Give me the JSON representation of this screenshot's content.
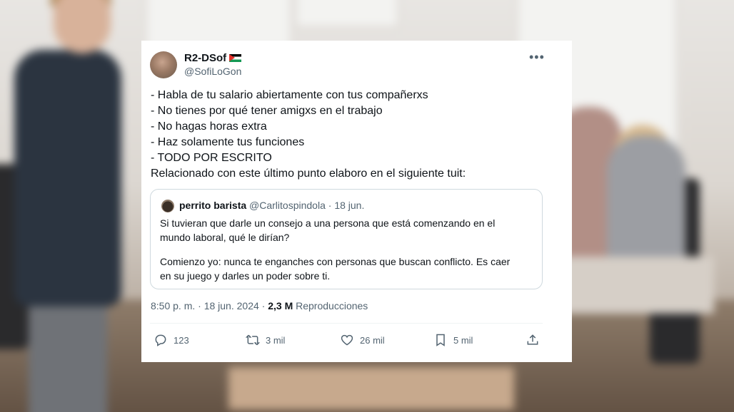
{
  "tweet": {
    "display_name": "R2-DSof",
    "flag_icon": "palestine-flag-icon",
    "handle": "@SofiLoGon",
    "body_lines": [
      "- Habla de tu salario abiertamente con tus compañerxs",
      "- No tienes por qué tener amigxs en el trabajo",
      "- No hagas horas extra",
      "- Haz solamente tus funciones",
      "- TODO POR ESCRITO",
      "Relacionado con este último punto elaboro en el siguiente tuit:"
    ],
    "quoted": {
      "display_name": "perrito barista",
      "handle": "@Carlitospindola",
      "separator": "·",
      "date": "18 jun.",
      "paragraph1_lines": [
        "Si tuvieran que darle un consejo a una persona que está comenzando en el",
        "mundo laboral, qué le dirían?"
      ],
      "paragraph2_lines": [
        "Comienzo yo: nunca te enganches con personas que buscan conflicto. Es caer",
        "en su juego y darles un poder sobre ti."
      ]
    },
    "timestamp": "8:50 p. m. · 18 jun. 2024 ·",
    "views_count": "2,3 M",
    "views_label": "Reproducciones",
    "actions": {
      "replies": "123",
      "retweets": "3 mil",
      "likes": "26 mil",
      "bookmarks": "5 mil"
    }
  },
  "colors": {
    "text_primary": "#0f1419",
    "text_secondary": "#536471",
    "border": "#cfd9de"
  }
}
